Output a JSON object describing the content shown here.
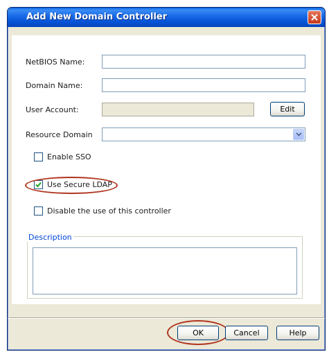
{
  "window": {
    "title": "Add New Domain Controller"
  },
  "form": {
    "netbios_label": "NetBIOS Name:",
    "netbios_value": "",
    "domain_label": "Domain Name:",
    "domain_value": "",
    "user_label": "User Account:",
    "user_value": "",
    "edit_label": "Edit",
    "resource_label": "Resource Domain",
    "resource_value": "",
    "enable_sso_label": "Enable SSO",
    "enable_sso_checked": false,
    "secure_ldap_label": "Use Secure LDAP",
    "secure_ldap_checked": true,
    "disable_controller_label": "Disable the use of this controller",
    "disable_controller_checked": false,
    "description_label": "Description",
    "description_value": ""
  },
  "buttons": {
    "ok": "OK",
    "cancel": "Cancel",
    "help": "Help"
  },
  "colors": {
    "title_bar": "#0552d6",
    "highlight_ring": "#b0341f",
    "dialog_bg": "#ece9d8"
  }
}
